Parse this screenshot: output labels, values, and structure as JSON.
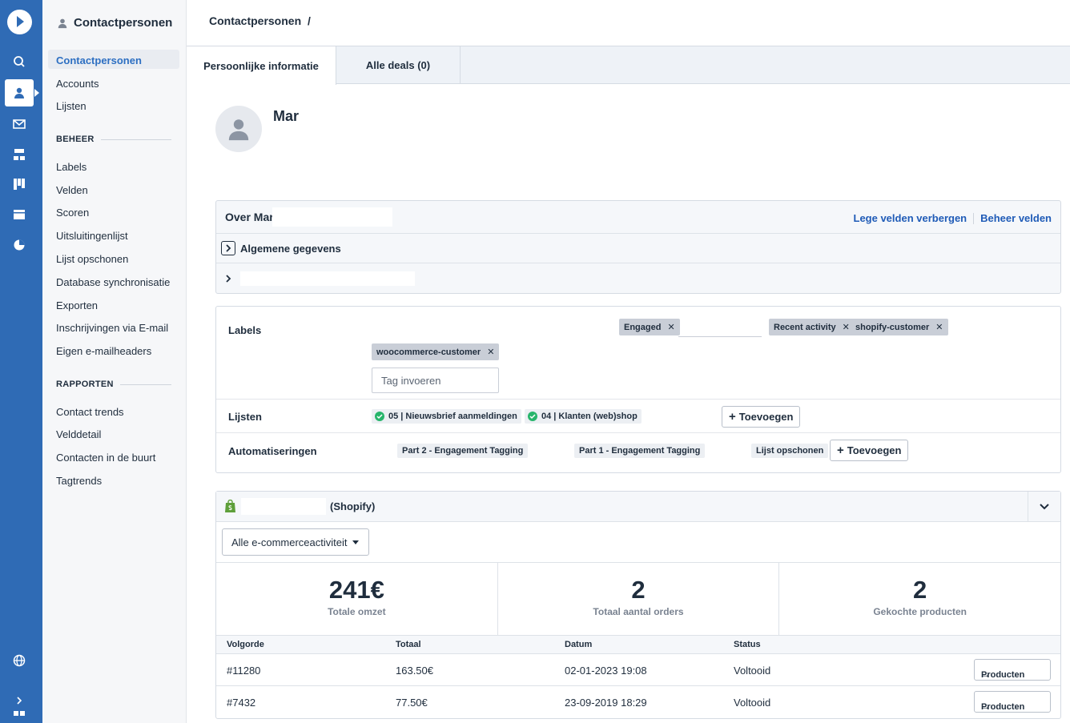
{
  "sidebar": {
    "title": "Contactpersonen",
    "items": [
      "Contactpersonen",
      "Accounts",
      "Lijsten"
    ],
    "beheer_label": "BEHEER",
    "beheer_items": [
      "Labels",
      "Velden",
      "Scoren",
      "Uitsluitingenlijst",
      "Lijst opschonen",
      "Database synchronisatie",
      "Exporten",
      "Inschrijvingen via E-mail",
      "Eigen e-mailheaders"
    ],
    "rapporten_label": "RAPPORTEN",
    "rapporten_items": [
      "Contact trends",
      "Velddetail",
      "Contacten in de buurt",
      "Tagtrends"
    ]
  },
  "breadcrumb": {
    "root": "Contactpersonen",
    "sep": "/"
  },
  "tabs": [
    "Persoonlijke informatie",
    "Alle deals (0)"
  ],
  "contact": {
    "name": "Mar"
  },
  "about": {
    "title": "Over Mar",
    "hide_empty": "Lege velden verbergen",
    "manage_fields": "Beheer velden",
    "section_general": "Algemene gegevens"
  },
  "labels": {
    "title": "Labels",
    "chips": [
      "Engaged",
      "Recent activity",
      "shopify-customer",
      "woocommerce-customer"
    ],
    "placeholder": "Tag invoeren"
  },
  "lists": {
    "title": "Lijsten",
    "chips": [
      "05 | Nieuwsbrief aanmeldingen",
      "04 | Klanten (web)shop"
    ],
    "add": "Toevoegen"
  },
  "automations": {
    "title": "Automatiseringen",
    "chips": [
      "Part 2 - Engagement Tagging",
      "Part 1 - Engagement Tagging",
      "Lijst opschonen"
    ],
    "add": "Toevoegen"
  },
  "shop": {
    "source": "(Shopify)",
    "filter": "Alle e-commerceactiviteit",
    "stats": [
      {
        "value": "241€",
        "label": "Totale omzet"
      },
      {
        "value": "2",
        "label": "Totaal aantal orders"
      },
      {
        "value": "2",
        "label": "Gekochte producten"
      }
    ],
    "columns": [
      "Volgorde",
      "Totaal",
      "Datum",
      "Status"
    ],
    "orders": [
      {
        "id": "#11280",
        "total": "163.50€",
        "date": "02-01-2023 19:08",
        "status": "Voltooid",
        "action": "Producten"
      },
      {
        "id": "#7432",
        "total": "77.50€",
        "date": "23-09-2019 18:29",
        "status": "Voltooid",
        "action": "Producten"
      }
    ]
  },
  "colors": {
    "rail": "#2f6bb5",
    "link": "#1f5bb7",
    "ok": "#27b56b"
  }
}
